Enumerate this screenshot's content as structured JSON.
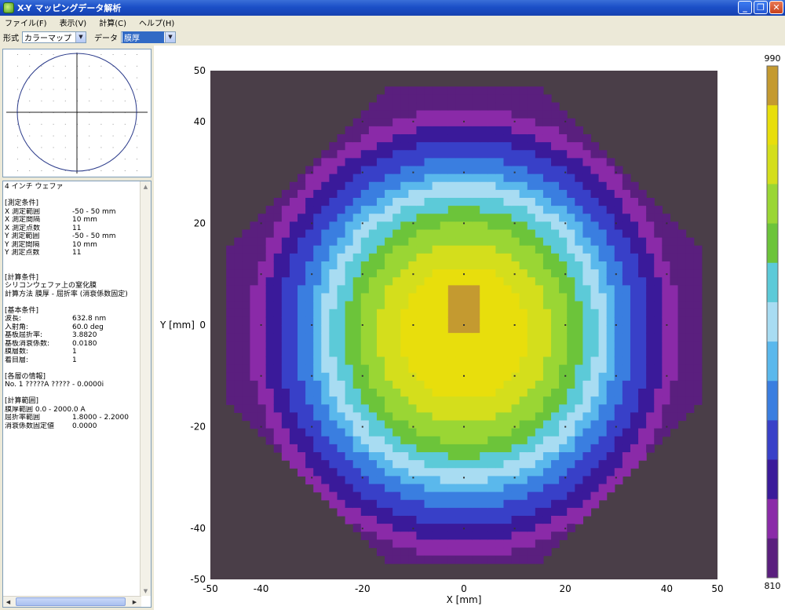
{
  "window": {
    "title": "X-Y マッピングデータ解析"
  },
  "menu": {
    "items": [
      "ファイル(F)",
      "表示(V)",
      "計算(C)",
      "ヘルプ(H)"
    ]
  },
  "toolbar": {
    "format_label": "形式",
    "format_value": "カラーマップ",
    "data_label": "データ",
    "data_value": "膜厚"
  },
  "info": {
    "wafer": "4 インチ ウェファ",
    "meas_header": "[測定条件]",
    "meas": [
      {
        "k": "X 測定範囲",
        "v": "-50 - 50 mm"
      },
      {
        "k": "X 測定間隔",
        "v": "10 mm"
      },
      {
        "k": "X 測定点数",
        "v": "11"
      },
      {
        "k": "Y 測定範囲",
        "v": "-50 - 50 mm"
      },
      {
        "k": "Y 測定間隔",
        "v": "10 mm"
      },
      {
        "k": "Y 測定点数",
        "v": "11"
      }
    ],
    "calc_header": "[計算条件]",
    "calc_line1": "シリコンウェファ上の窒化膜",
    "calc_line2": "計算方法 膜厚 - 屈折率 (消衰係数固定)",
    "basic_header": "[基本条件]",
    "basic": [
      {
        "k": "波長:",
        "v": "632.8 nm"
      },
      {
        "k": "入射角:",
        "v": "60.0 deg"
      },
      {
        "k": "基板屈折率:",
        "v": "3.8820"
      },
      {
        "k": "基板消衰係数:",
        "v": "0.0180"
      },
      {
        "k": "膜層数:",
        "v": "1"
      },
      {
        "k": "着目層:",
        "v": "1"
      }
    ],
    "layer_header": "[各層の情報]",
    "layer_line": "No. 1       ?????A  ????? - 0.0000i",
    "range_header": "[計算範囲]",
    "ranges": [
      {
        "k": "膜厚範囲 0.0 - 2000.0 A",
        "v": ""
      },
      {
        "k": "屈折率範囲",
        "v": "1.8000 - 2.2000"
      },
      {
        "k": "消衰係数固定値",
        "v": "0.0000"
      }
    ]
  },
  "chart_data": {
    "type": "heatmap",
    "xlabel": "X [mm]",
    "ylabel": "Y [mm]",
    "xlim": [
      -50,
      50
    ],
    "ylim": [
      -50,
      50
    ],
    "x_ticks": [
      -50,
      -40,
      -20,
      0,
      20,
      40,
      50
    ],
    "y_ticks": [
      50,
      40,
      20,
      0,
      -20,
      -40,
      -50
    ],
    "colorbar_min": 810,
    "colorbar_max": 990,
    "colorbar_max_label": "990",
    "colorbar_min_label": "810",
    "outside_color": "#4a3e48",
    "levels": [
      {
        "min": 810,
        "color": "#5a1f7e"
      },
      {
        "min": 840,
        "color": "#8a2aa8"
      },
      {
        "min": 860,
        "color": "#3a1a9a"
      },
      {
        "min": 880,
        "color": "#3840c8"
      },
      {
        "min": 900,
        "color": "#3a7ee0"
      },
      {
        "min": 915,
        "color": "#5ab8ec"
      },
      {
        "min": 925,
        "color": "#a8dcf2"
      },
      {
        "min": 935,
        "color": "#5ccad8"
      },
      {
        "min": 945,
        "color": "#6cc43a"
      },
      {
        "min": 955,
        "color": "#9ad634"
      },
      {
        "min": 965,
        "color": "#d4de1c"
      },
      {
        "min": 975,
        "color": "#e8de0c"
      },
      {
        "min": 985,
        "color": "#c49a30"
      }
    ],
    "wafer_radius_mm": 50,
    "center_value": 985,
    "edge_value": 810
  }
}
